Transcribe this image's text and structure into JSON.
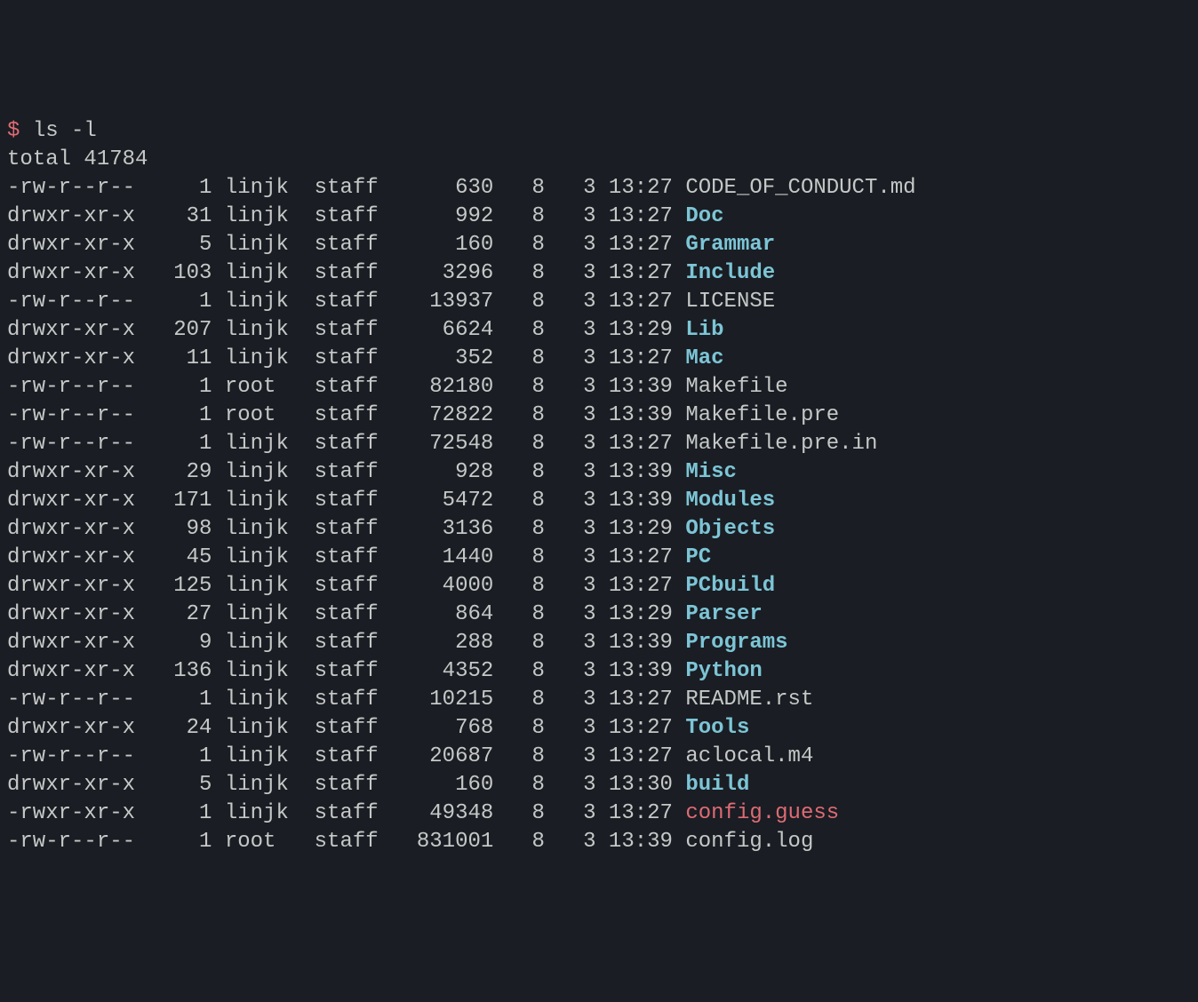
{
  "prompt": "$",
  "command": "ls -l",
  "total_line": "total 41784",
  "entries": [
    {
      "perms": "-rw-r--r--",
      "links": "1",
      "owner": "linjk",
      "group": "staff",
      "size": "630",
      "month": "8",
      "day": "3",
      "time": "13:27",
      "name": "CODE_OF_CONDUCT.md",
      "type": "file"
    },
    {
      "perms": "drwxr-xr-x",
      "links": "31",
      "owner": "linjk",
      "group": "staff",
      "size": "992",
      "month": "8",
      "day": "3",
      "time": "13:27",
      "name": "Doc",
      "type": "dir"
    },
    {
      "perms": "drwxr-xr-x",
      "links": "5",
      "owner": "linjk",
      "group": "staff",
      "size": "160",
      "month": "8",
      "day": "3",
      "time": "13:27",
      "name": "Grammar",
      "type": "dir"
    },
    {
      "perms": "drwxr-xr-x",
      "links": "103",
      "owner": "linjk",
      "group": "staff",
      "size": "3296",
      "month": "8",
      "day": "3",
      "time": "13:27",
      "name": "Include",
      "type": "dir"
    },
    {
      "perms": "-rw-r--r--",
      "links": "1",
      "owner": "linjk",
      "group": "staff",
      "size": "13937",
      "month": "8",
      "day": "3",
      "time": "13:27",
      "name": "LICENSE",
      "type": "file"
    },
    {
      "perms": "drwxr-xr-x",
      "links": "207",
      "owner": "linjk",
      "group": "staff",
      "size": "6624",
      "month": "8",
      "day": "3",
      "time": "13:29",
      "name": "Lib",
      "type": "dir"
    },
    {
      "perms": "drwxr-xr-x",
      "links": "11",
      "owner": "linjk",
      "group": "staff",
      "size": "352",
      "month": "8",
      "day": "3",
      "time": "13:27",
      "name": "Mac",
      "type": "dir"
    },
    {
      "perms": "-rw-r--r--",
      "links": "1",
      "owner": "root",
      "group": "staff",
      "size": "82180",
      "month": "8",
      "day": "3",
      "time": "13:39",
      "name": "Makefile",
      "type": "file"
    },
    {
      "perms": "-rw-r--r--",
      "links": "1",
      "owner": "root",
      "group": "staff",
      "size": "72822",
      "month": "8",
      "day": "3",
      "time": "13:39",
      "name": "Makefile.pre",
      "type": "file"
    },
    {
      "perms": "-rw-r--r--",
      "links": "1",
      "owner": "linjk",
      "group": "staff",
      "size": "72548",
      "month": "8",
      "day": "3",
      "time": "13:27",
      "name": "Makefile.pre.in",
      "type": "file"
    },
    {
      "perms": "drwxr-xr-x",
      "links": "29",
      "owner": "linjk",
      "group": "staff",
      "size": "928",
      "month": "8",
      "day": "3",
      "time": "13:39",
      "name": "Misc",
      "type": "dir"
    },
    {
      "perms": "drwxr-xr-x",
      "links": "171",
      "owner": "linjk",
      "group": "staff",
      "size": "5472",
      "month": "8",
      "day": "3",
      "time": "13:39",
      "name": "Modules",
      "type": "dir"
    },
    {
      "perms": "drwxr-xr-x",
      "links": "98",
      "owner": "linjk",
      "group": "staff",
      "size": "3136",
      "month": "8",
      "day": "3",
      "time": "13:29",
      "name": "Objects",
      "type": "dir"
    },
    {
      "perms": "drwxr-xr-x",
      "links": "45",
      "owner": "linjk",
      "group": "staff",
      "size": "1440",
      "month": "8",
      "day": "3",
      "time": "13:27",
      "name": "PC",
      "type": "dir"
    },
    {
      "perms": "drwxr-xr-x",
      "links": "125",
      "owner": "linjk",
      "group": "staff",
      "size": "4000",
      "month": "8",
      "day": "3",
      "time": "13:27",
      "name": "PCbuild",
      "type": "dir"
    },
    {
      "perms": "drwxr-xr-x",
      "links": "27",
      "owner": "linjk",
      "group": "staff",
      "size": "864",
      "month": "8",
      "day": "3",
      "time": "13:29",
      "name": "Parser",
      "type": "dir"
    },
    {
      "perms": "drwxr-xr-x",
      "links": "9",
      "owner": "linjk",
      "group": "staff",
      "size": "288",
      "month": "8",
      "day": "3",
      "time": "13:39",
      "name": "Programs",
      "type": "dir"
    },
    {
      "perms": "drwxr-xr-x",
      "links": "136",
      "owner": "linjk",
      "group": "staff",
      "size": "4352",
      "month": "8",
      "day": "3",
      "time": "13:39",
      "name": "Python",
      "type": "dir"
    },
    {
      "perms": "-rw-r--r--",
      "links": "1",
      "owner": "linjk",
      "group": "staff",
      "size": "10215",
      "month": "8",
      "day": "3",
      "time": "13:27",
      "name": "README.rst",
      "type": "file"
    },
    {
      "perms": "drwxr-xr-x",
      "links": "24",
      "owner": "linjk",
      "group": "staff",
      "size": "768",
      "month": "8",
      "day": "3",
      "time": "13:27",
      "name": "Tools",
      "type": "dir"
    },
    {
      "perms": "-rw-r--r--",
      "links": "1",
      "owner": "linjk",
      "group": "staff",
      "size": "20687",
      "month": "8",
      "day": "3",
      "time": "13:27",
      "name": "aclocal.m4",
      "type": "file"
    },
    {
      "perms": "drwxr-xr-x",
      "links": "5",
      "owner": "linjk",
      "group": "staff",
      "size": "160",
      "month": "8",
      "day": "3",
      "time": "13:30",
      "name": "build",
      "type": "dir"
    },
    {
      "perms": "-rwxr-xr-x",
      "links": "1",
      "owner": "linjk",
      "group": "staff",
      "size": "49348",
      "month": "8",
      "day": "3",
      "time": "13:27",
      "name": "config.guess",
      "type": "exec"
    },
    {
      "perms": "-rw-r--r--",
      "links": "1",
      "owner": "root",
      "group": "staff",
      "size": "831001",
      "month": "8",
      "day": "3",
      "time": "13:39",
      "name": "config.log",
      "type": "file"
    }
  ]
}
